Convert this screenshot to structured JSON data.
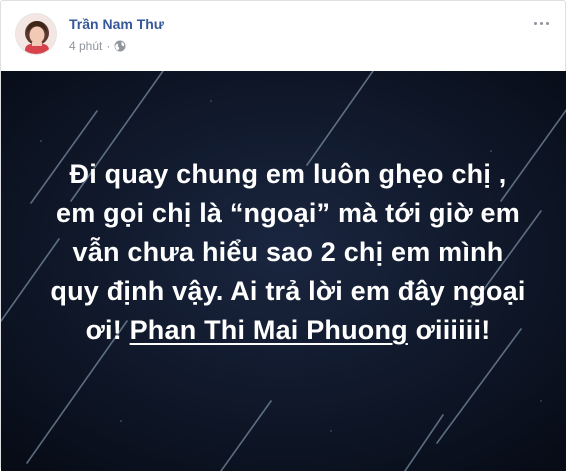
{
  "post": {
    "author": "Trần Nam Thư",
    "time": "4 phút",
    "privacy_icon": "globe-icon",
    "more_icon": "more-options-icon",
    "text_before": "Đi quay chung em luôn ghẹo chị , em gọi chị là “ngoại” mà tới giờ em vẫn chưa hiểu sao 2 chị em mình quy định vậy. Ai trả lời em đây ngoại ơi! ",
    "mention": "Phan Thi Mai Phuong",
    "text_after": " ơiiiiii!"
  },
  "colors": {
    "name": "#365899",
    "meta": "#90949c",
    "background": "#0d1525",
    "text": "#ffffff"
  }
}
